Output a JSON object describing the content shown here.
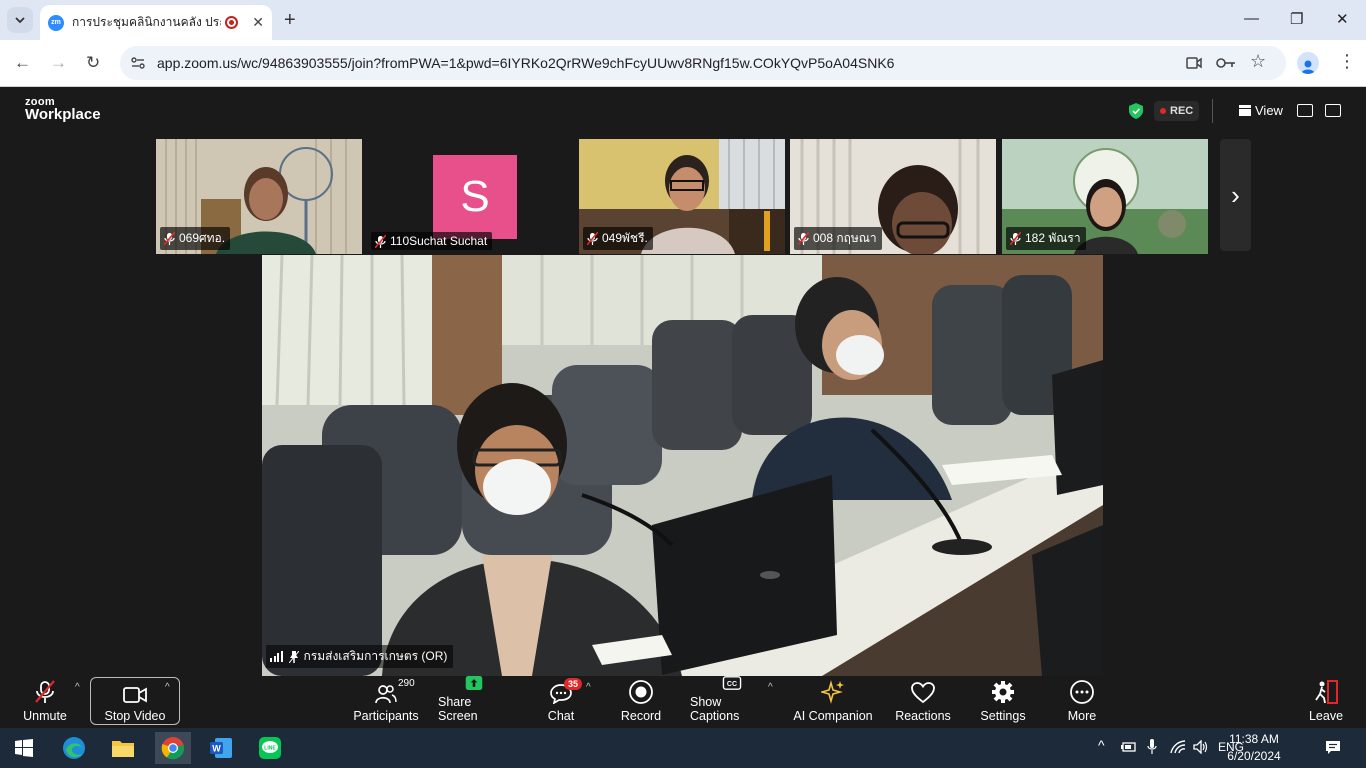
{
  "browser": {
    "tab_title": "การประชุมคลินิกงานคลัง ประจำปี",
    "tab_favicon_text": "zm",
    "url": "app.zoom.us/wc/94863903555/join?fromPWA=1&pwd=6IYRKo2QrRWe9chFcyUUwv8RNgf15w.COkYQvP5oA04SNK6"
  },
  "zoom_header": {
    "logo_top": "zoom",
    "logo_bottom": "Workplace",
    "rec_label": "REC",
    "view_label": "View"
  },
  "participants_strip": [
    {
      "name": "069ศทอ.",
      "muted": true
    },
    {
      "name": "110Suchat Suchat",
      "muted": true,
      "avatar_letter": "S",
      "avatar_color": "#e8508b"
    },
    {
      "name": "049พัชรี.",
      "muted": true
    },
    {
      "name": "008 กฤษณา",
      "muted": true
    },
    {
      "name": "182 พัณรา",
      "muted": true
    }
  ],
  "main_video": {
    "speaker_label": "กรมส่งเสริมการเกษตร (OR)"
  },
  "toolbar": {
    "unmute": "Unmute",
    "stop_video": "Stop Video",
    "participants": "Participants",
    "participants_count": "290",
    "share_screen": "Share Screen",
    "chat": "Chat",
    "chat_badge": "35",
    "record": "Record",
    "show_captions": "Show Captions",
    "ai_companion": "AI Companion",
    "reactions": "Reactions",
    "settings": "Settings",
    "more": "More",
    "leave": "Leave"
  },
  "taskbar": {
    "language": "ENG",
    "time": "11:38 AM",
    "date": "6/20/2024"
  },
  "colors": {
    "zoom_blue": "#2d8cff",
    "rec_red": "#e02828",
    "share_green": "#22c55e",
    "taskbar_bg": "#1d2a3a"
  }
}
